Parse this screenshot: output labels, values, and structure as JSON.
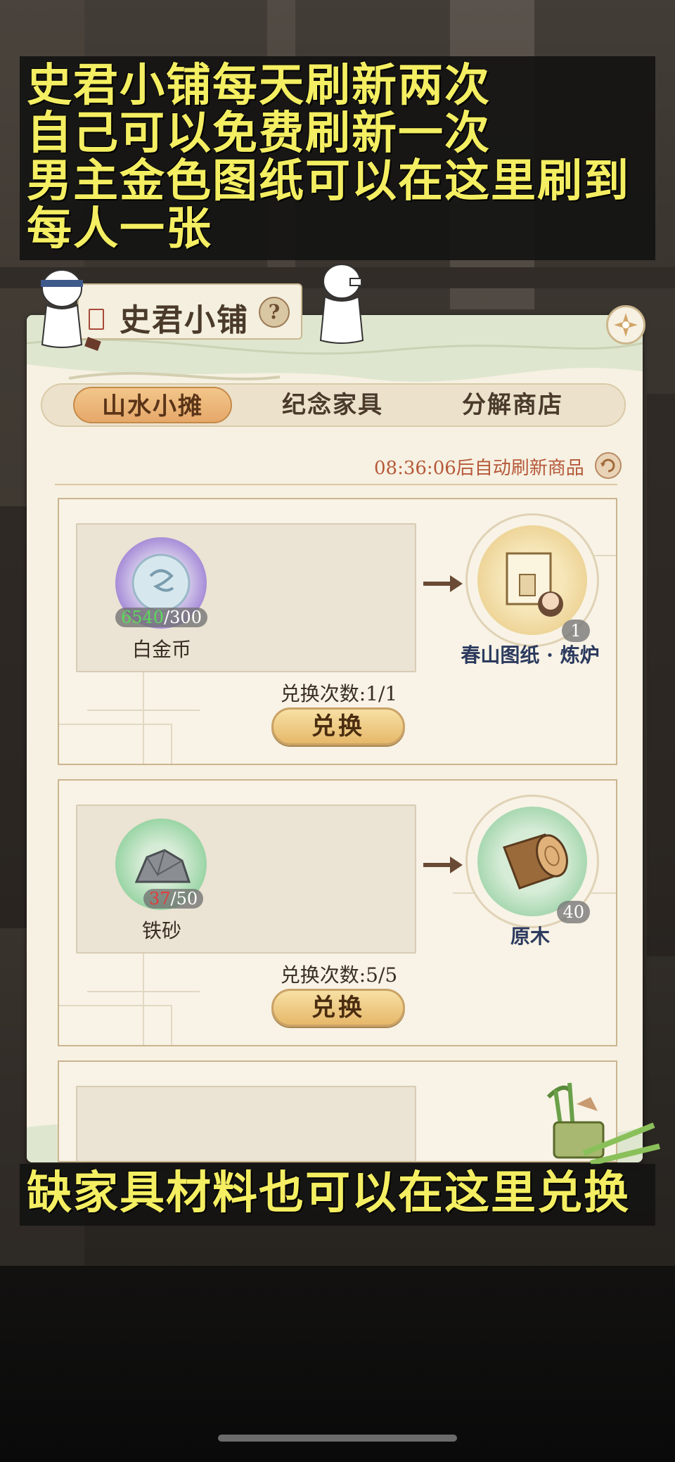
{
  "caption_top": {
    "line1": "史君小铺每天刷新两次",
    "line2": "自己可以免费刷新一次",
    "line3": "男主金色图纸可以在这里刷到",
    "line4": "每人一张"
  },
  "caption_bottom": "缺家具材料也可以在这里兑换",
  "shop": {
    "title": "史君小铺",
    "help_label": "?",
    "tabs": [
      {
        "label": "山水小摊",
        "active": true
      },
      {
        "label": "纪念家具",
        "active": false
      },
      {
        "label": "分解商店",
        "active": false
      }
    ],
    "refresh_text": "08:36:06后自动刷新商品",
    "items": [
      {
        "cost_have": "6540",
        "cost_need": "/300",
        "cost_name": "白金币",
        "reward_name": "春山图纸 · 炼炉",
        "reward_count": "1",
        "times_label": "兑换次数:1/1",
        "button_label": "兑换"
      },
      {
        "cost_have": "37",
        "cost_need": "/50",
        "cost_name": "铁砂",
        "reward_name": "原木",
        "reward_count": "40",
        "times_label": "兑换次数:5/5",
        "button_label": "兑换"
      }
    ]
  },
  "colors": {
    "caption_text": "#f4ee62",
    "have_sufficient": "#5cd85c",
    "have_insufficient": "#e43a3a",
    "refresh_text": "#b6583a"
  }
}
